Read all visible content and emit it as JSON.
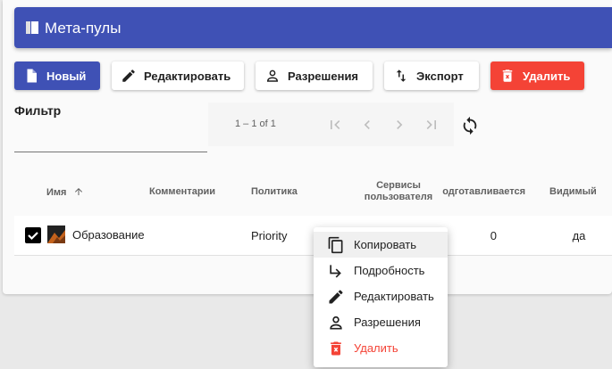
{
  "header": {
    "title": "Мета-пулы",
    "icon": "book-icon"
  },
  "toolbar": {
    "new_label": "Новый",
    "edit_label": "Редактировать",
    "permissions_label": "Разрешения",
    "export_label": "Экспорт",
    "delete_label": "Удалить"
  },
  "filter": {
    "label": "Фильтр",
    "value": ""
  },
  "paginator": {
    "range": "1 – 1 of 1"
  },
  "table": {
    "columns": [
      "Имя",
      "Комментарии",
      "Политика",
      "Сервисы пользователя",
      "Подготавливается",
      "Видимый"
    ],
    "sort_column": "Имя",
    "rows": [
      {
        "name": "Образование",
        "comments": "",
        "policy": "Priority",
        "services": "",
        "preparing": "0",
        "visible": "да",
        "checked": true
      }
    ]
  },
  "context_menu": {
    "items": [
      {
        "label": "Копировать",
        "icon": "copy-icon"
      },
      {
        "label": "Подробность",
        "icon": "subdirectory-arrow-icon"
      },
      {
        "label": "Редактировать",
        "icon": "pencil-icon"
      },
      {
        "label": "Разрешения",
        "icon": "person-icon"
      },
      {
        "label": "Удалить",
        "icon": "trash-icon"
      }
    ]
  },
  "colors": {
    "primary": "#3f51b5",
    "danger": "#f44336"
  }
}
